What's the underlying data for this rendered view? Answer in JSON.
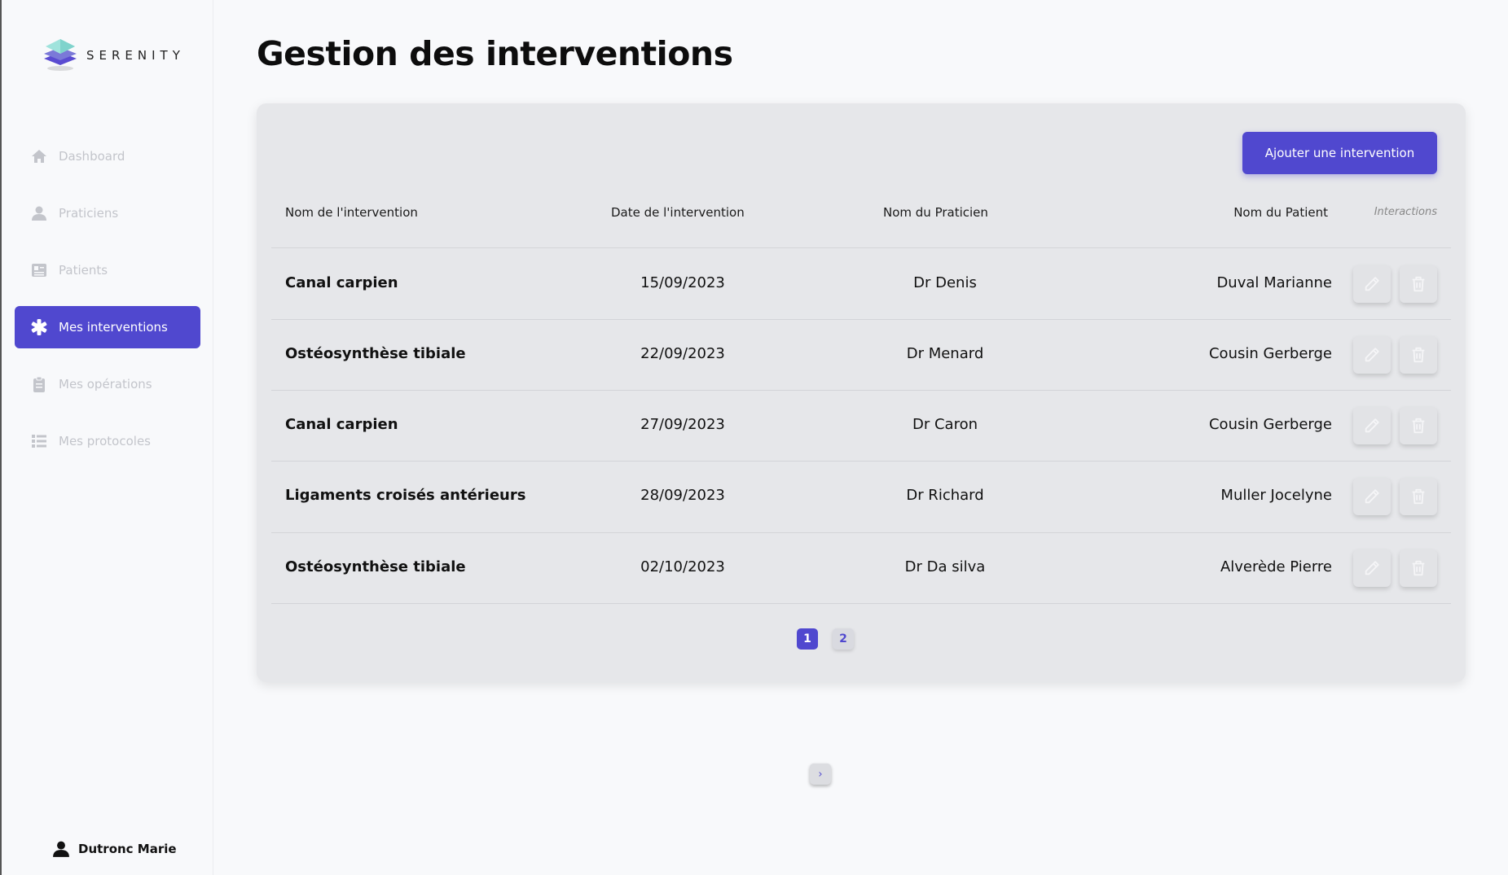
{
  "app": {
    "brand": "SERENITY"
  },
  "sidebar": {
    "items": [
      {
        "label": "Dashboard",
        "icon": "home-icon",
        "active": false
      },
      {
        "label": "Praticiens",
        "icon": "user-icon",
        "active": false
      },
      {
        "label": "Patients",
        "icon": "id-card-icon",
        "active": false
      },
      {
        "label": "Mes interventions",
        "icon": "asterisk-icon",
        "active": true
      },
      {
        "label": "Mes opérations",
        "icon": "clipboard-icon",
        "active": false
      },
      {
        "label": "Mes protocoles",
        "icon": "list-icon",
        "active": false
      }
    ],
    "user": {
      "name": "Dutronc Marie",
      "icon": "user-icon"
    }
  },
  "main": {
    "title": "Gestion des interventions",
    "add_button": "Ajouter une intervention",
    "columns": {
      "name": "Nom de l'intervention",
      "date": "Date de l'intervention",
      "practitioner": "Nom du Praticien",
      "patient": "Nom du Patient",
      "interactions": "Interactions"
    },
    "rows": [
      {
        "name": "Canal carpien",
        "date": "15/09/2023",
        "practitioner": "Dr Denis",
        "patient": "Duval Marianne"
      },
      {
        "name": "Ostéosynthèse tibiale",
        "date": "22/09/2023",
        "practitioner": "Dr Menard",
        "patient": "Cousin Gerberge"
      },
      {
        "name": "Canal carpien",
        "date": "27/09/2023",
        "practitioner": "Dr Caron",
        "patient": "Cousin Gerberge"
      },
      {
        "name": "Ligaments croisés antérieurs",
        "date": "28/09/2023",
        "practitioner": "Dr Richard",
        "patient": "Muller Jocelyne"
      },
      {
        "name": "Ostéosynthèse tibiale",
        "date": "02/10/2023",
        "practitioner": "Dr Da silva",
        "patient": "Alverède Pierre"
      }
    ],
    "pagination": {
      "prev": "‹",
      "pages": [
        "1",
        "2"
      ],
      "current": "1",
      "next": "›"
    }
  },
  "colors": {
    "accent": "#5048cf",
    "card": "#e6e7ea",
    "background": "#f8f9fb"
  }
}
